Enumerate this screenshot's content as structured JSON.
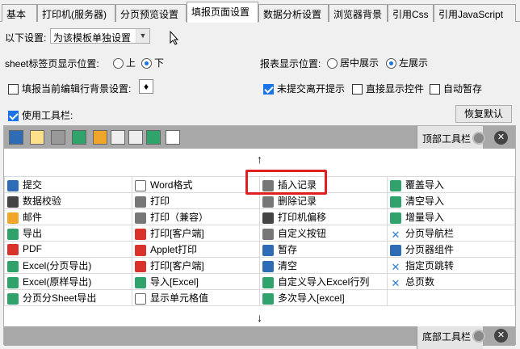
{
  "tabs": [
    "基本",
    "打印机(服务器)",
    "分页预览设置",
    "填报页面设置",
    "数据分析设置",
    "浏览器背景",
    "引用Css",
    "引用JavaScript"
  ],
  "settings": {
    "label": "以下设置:",
    "select_value": "为该模板单独设置",
    "sheet_label": "sheet标签页显示位置:",
    "sheet_top": "上",
    "sheet_bottom": "下",
    "report_label": "报表显示位置:",
    "report_center": "居中展示",
    "report_left": "左展示",
    "fill_bg_label": "填报当前编辑行背景设置:",
    "unsubmitted_label": "未提交离开提示",
    "direct_control_label": "直接显示控件",
    "autosave_label": "自动暂存",
    "use_toolbar_label": "使用工具栏:",
    "restore_default": "恢复默认"
  },
  "toolbar": {
    "top_label": "顶部工具栏",
    "bottom_label": "底部工具栏"
  },
  "grid": [
    [
      {
        "icon": "save",
        "cls": "ic-blue",
        "label": "提交"
      },
      {
        "icon": "word",
        "cls": "ic-doc",
        "label": "Word格式"
      },
      {
        "icon": "insert",
        "cls": "ic-grey",
        "label": "插入记录"
      },
      {
        "icon": "cover",
        "cls": "ic-green",
        "label": "覆盖导入"
      }
    ],
    [
      {
        "icon": "verify",
        "cls": "ic-dark",
        "label": "数据校验"
      },
      {
        "icon": "print",
        "cls": "ic-grey",
        "label": "打印"
      },
      {
        "icon": "delete",
        "cls": "ic-grey",
        "label": "删除记录"
      },
      {
        "icon": "clear-import",
        "cls": "ic-green",
        "label": "清空导入"
      }
    ],
    [
      {
        "icon": "mail",
        "cls": "ic-orange",
        "label": "邮件"
      },
      {
        "icon": "print",
        "cls": "ic-grey",
        "label": "打印（兼容）"
      },
      {
        "icon": "move",
        "cls": "ic-dark",
        "label": "打印机偏移"
      },
      {
        "icon": "incr",
        "cls": "ic-green",
        "label": "增量导入"
      }
    ],
    [
      {
        "icon": "export",
        "cls": "ic-green",
        "label": "导出"
      },
      {
        "icon": "print-client",
        "cls": "ic-red",
        "label": "打印[客户端]"
      },
      {
        "icon": "gear",
        "cls": "ic-grey",
        "label": "自定义按钮"
      },
      {
        "icon": "pagenav",
        "cls": "ic-xx",
        "label": "分页导航栏"
      }
    ],
    [
      {
        "icon": "pdf",
        "cls": "ic-red",
        "label": "PDF"
      },
      {
        "icon": "applet",
        "cls": "ic-red",
        "label": "Applet打印"
      },
      {
        "icon": "hold",
        "cls": "ic-blue",
        "label": "暂存"
      },
      {
        "icon": "pagecomp",
        "cls": "ic-blue",
        "label": "分页器组件"
      }
    ],
    [
      {
        "icon": "excel",
        "cls": "ic-green",
        "label": "Excel(分页导出)"
      },
      {
        "icon": "pdf",
        "cls": "ic-red",
        "label": "打印[客户端]"
      },
      {
        "icon": "clear",
        "cls": "ic-blue",
        "label": "清空"
      },
      {
        "icon": "jump",
        "cls": "ic-xx",
        "label": "指定页跳转"
      }
    ],
    [
      {
        "icon": "excel",
        "cls": "ic-green",
        "label": "Excel(原样导出)"
      },
      {
        "icon": "excel",
        "cls": "ic-green",
        "label": "导入[Excel]"
      },
      {
        "icon": "excel",
        "cls": "ic-green",
        "label": "自定义导入Excel行列"
      },
      {
        "icon": "total",
        "cls": "ic-xx",
        "label": "总页数"
      }
    ],
    [
      {
        "icon": "sheet",
        "cls": "ic-green",
        "label": "分页分Sheet导出"
      },
      {
        "icon": "cell",
        "cls": "ic-doc",
        "label": "显示单元格值"
      },
      {
        "icon": "multi",
        "cls": "ic-green",
        "label": "多次导入[excel]"
      },
      {
        "icon": "",
        "cls": "",
        "label": ""
      }
    ]
  ]
}
